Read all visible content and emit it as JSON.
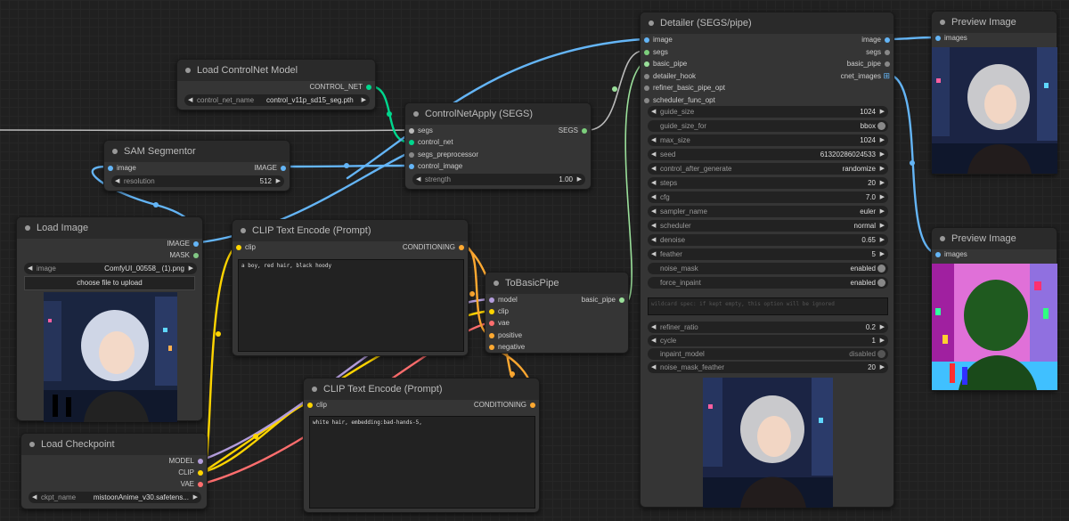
{
  "nodes": {
    "load_controlnet": {
      "title": "Load ControlNet Model",
      "out_control_net": "CONTROL_NET",
      "control_net_name_label": "control_net_name",
      "control_net_name_value": "control_v11p_sd15_seg.pth"
    },
    "sam_segmentor": {
      "title": "SAM Segmentor",
      "in_image": "image",
      "out_image": "IMAGE",
      "resolution_label": "resolution",
      "resolution_value": "512"
    },
    "load_image": {
      "title": "Load Image",
      "out_image": "IMAGE",
      "out_mask": "MASK",
      "image_label": "image",
      "image_value": "ComfyUI_00558_ (1).png",
      "upload_button": "choose file to upload"
    },
    "load_checkpoint": {
      "title": "Load Checkpoint",
      "out_model": "MODEL",
      "out_clip": "CLIP",
      "out_vae": "VAE",
      "ckpt_label": "ckpt_name",
      "ckpt_value": "mistoonAnime_v30.safetens..."
    },
    "controlnet_apply": {
      "title": "ControlNetApply (SEGS)",
      "in_segs": "segs",
      "in_control_net": "control_net",
      "in_segs_preprocessor": "segs_preprocessor",
      "in_control_image": "control_image",
      "out_segs": "SEGS",
      "strength_label": "strength",
      "strength_value": "1.00"
    },
    "clip_text_1": {
      "title": "CLIP Text Encode (Prompt)",
      "in_clip": "clip",
      "out_conditioning": "CONDITIONING",
      "text": "a boy, red hair, black hoody"
    },
    "clip_text_2": {
      "title": "CLIP Text Encode (Prompt)",
      "in_clip": "clip",
      "out_conditioning": "CONDITIONING",
      "text": "white hair, embedding:bad-hands-5,"
    },
    "to_basic_pipe": {
      "title": "ToBasicPipe",
      "in_model": "model",
      "in_clip": "clip",
      "in_vae": "vae",
      "in_positive": "positive",
      "in_negative": "negative",
      "out_basic_pipe": "basic_pipe"
    },
    "detailer": {
      "title": "Detailer (SEGS/pipe)",
      "inputs": [
        "image",
        "segs",
        "basic_pipe",
        "detailer_hook",
        "refiner_basic_pipe_opt",
        "scheduler_func_opt"
      ],
      "outputs": [
        "image",
        "segs",
        "basic_pipe",
        "cnet_images"
      ],
      "widgets": [
        {
          "label": "guide_size",
          "value": "1024",
          "kind": "number"
        },
        {
          "label": "guide_size_for",
          "value": "bbox",
          "kind": "toggle"
        },
        {
          "label": "max_size",
          "value": "1024",
          "kind": "number"
        },
        {
          "label": "seed",
          "value": "61320286024533",
          "kind": "number"
        },
        {
          "label": "control_after_generate",
          "value": "randomize",
          "kind": "number"
        },
        {
          "label": "steps",
          "value": "20",
          "kind": "number"
        },
        {
          "label": "cfg",
          "value": "7.0",
          "kind": "number"
        },
        {
          "label": "sampler_name",
          "value": "euler",
          "kind": "number"
        },
        {
          "label": "scheduler",
          "value": "normal",
          "kind": "number"
        },
        {
          "label": "denoise",
          "value": "0.65",
          "kind": "number"
        },
        {
          "label": "feather",
          "value": "5",
          "kind": "number"
        },
        {
          "label": "noise_mask",
          "value": "enabled",
          "kind": "toggle"
        },
        {
          "label": "force_inpaint",
          "value": "enabled",
          "kind": "toggle"
        }
      ],
      "wildcard_placeholder": "wildcard spec: if kept empty, this option will be ignored",
      "widgets_2": [
        {
          "label": "refiner_ratio",
          "value": "0.2",
          "kind": "number"
        },
        {
          "label": "cycle",
          "value": "1",
          "kind": "number"
        },
        {
          "label": "inpaint_model",
          "value": "disabled",
          "kind": "toggle-dim"
        },
        {
          "label": "noise_mask_feather",
          "value": "20",
          "kind": "number"
        }
      ]
    },
    "preview_1": {
      "title": "Preview Image",
      "in_images": "images"
    },
    "preview_2": {
      "title": "Preview Image",
      "in_images": "images"
    }
  },
  "icons": {
    "arrow_left": "◀",
    "arrow_right": "▶",
    "grid": "⊞"
  },
  "colors": {
    "image": "#64b5f6",
    "mask": "#81c784",
    "model": "#b39ddb",
    "clip": "#ffd500",
    "vae": "#ff6e6e",
    "conditioning": "#ffa931",
    "control_net": "#00d78d",
    "segs": "#7ccf7c",
    "basic_pipe": "#9adf9a",
    "misc": "#aaaaaa"
  }
}
